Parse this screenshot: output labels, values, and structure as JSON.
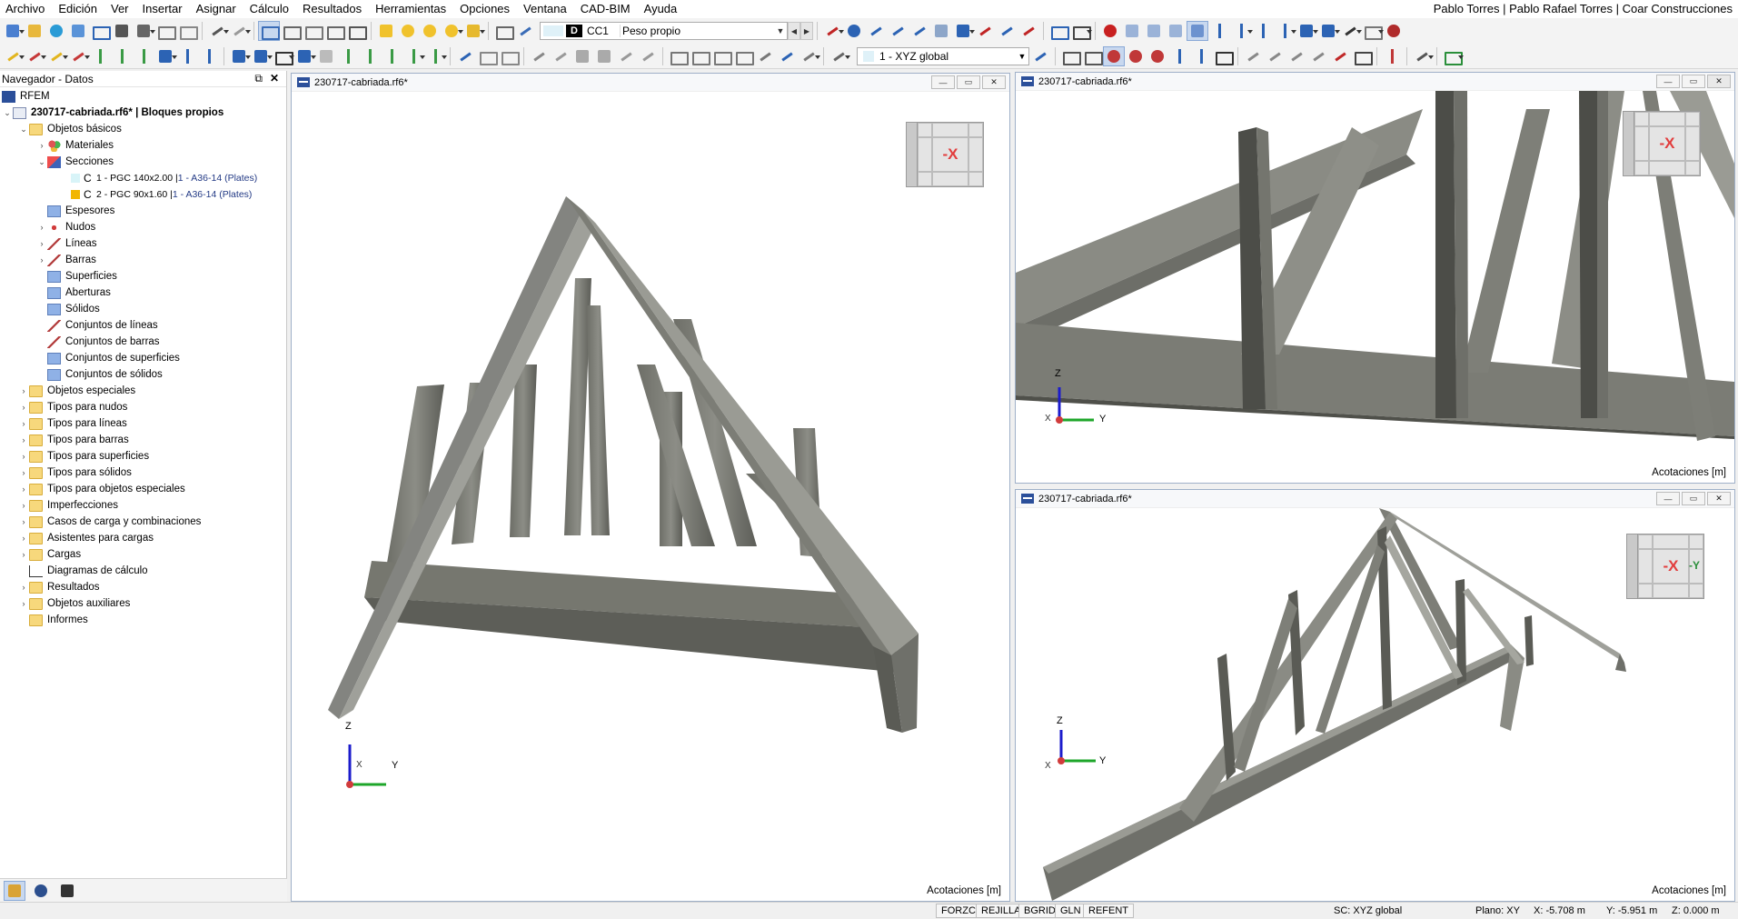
{
  "menu": [
    "Archivo",
    "Edición",
    "Ver",
    "Insertar",
    "Asignar",
    "Cálculo",
    "Resultados",
    "Herramientas",
    "Opciones",
    "Ventana",
    "CAD-BIM",
    "Ayuda"
  ],
  "user": "Pablo Torres | Pablo Rafael Torres | Coar Construcciones",
  "toolbar": {
    "loadcase_type": "D",
    "loadcase_id": "CC1",
    "loadcase_name": "Peso propio",
    "coord_system": "1 - XYZ global"
  },
  "navigator": {
    "title": "Navegador - Datos",
    "root": "RFEM",
    "file": "230717-cabriada.rf6* | Bloques propios",
    "objetos_basicos": "Objetos básicos",
    "basic_items": [
      "Materiales",
      "Secciones",
      "Espesores",
      "Nudos",
      "Líneas",
      "Barras",
      "Superficies",
      "Aberturas",
      "Sólidos",
      "Conjuntos de líneas",
      "Conjuntos de barras",
      "Conjuntos de superficies",
      "Conjuntos de sólidos"
    ],
    "sections": [
      {
        "glyph": "C",
        "name": "1 - PGC 140x2.00 | ",
        "material": "1 - A36-14 (Plates)",
        "color": "#d8f4f8"
      },
      {
        "glyph": "C",
        "name": "2 - PGC 90x1.60 | ",
        "material": "1 - A36-14 (Plates)",
        "color": "#f2b600"
      }
    ],
    "folders": [
      "Objetos especiales",
      "Tipos para nudos",
      "Tipos para líneas",
      "Tipos para barras",
      "Tipos para superficies",
      "Tipos para sólidos",
      "Tipos para objetos especiales",
      "Imperfecciones",
      "Casos de carga y combinaciones",
      "Asistentes para cargas",
      "Cargas",
      "Diagramas de cálculo",
      "Resultados",
      "Objetos auxiliares",
      "Informes"
    ]
  },
  "viewports": {
    "main": {
      "title": "230717-cabriada.rf6*",
      "dim": "Acotaciones [m]",
      "cube": "-X",
      "axes": {
        "z": "Z",
        "x": "X",
        "y": "Y"
      }
    },
    "top_right": {
      "title": "230717-cabriada.rf6*",
      "dim": "Acotaciones [m]",
      "cube": "-X",
      "axes": {
        "z": "Z",
        "x": "X",
        "y": "Y"
      }
    },
    "bottom_right": {
      "title": "230717-cabriada.rf6*",
      "dim": "Acotaciones [m]",
      "cube": "-X",
      "cube_y": "-Y",
      "axes": {
        "z": "Z",
        "x": "X",
        "y": "Y"
      }
    }
  },
  "status": {
    "toggles": [
      "FORZC",
      "REJILLA",
      "BGRID",
      "GLN",
      "REFENT"
    ],
    "sc": "SC: XYZ global",
    "plane": "Plano: XY",
    "x": "X: -5.708 m",
    "y": "Y: -5.951 m",
    "z": "Z: 0.000 m"
  },
  "colors": {
    "steel_dark": "#5f5f58",
    "steel_mid": "#83837b",
    "steel_light": "#a9aaa3",
    "accent": "#2b4f9a"
  }
}
